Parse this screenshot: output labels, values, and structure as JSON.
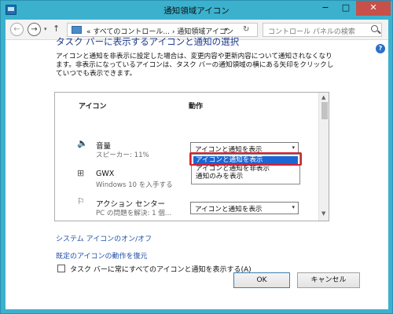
{
  "window": {
    "title": "通知領域アイコン",
    "minimize_glyph": "−",
    "maximize_glyph": "□",
    "close_glyph": "✕"
  },
  "nav": {
    "back_glyph": "←",
    "forward_glyph": "→",
    "history_glyph": "▾",
    "up_glyph": "↑",
    "address_path": "« すべてのコントロール... › 通知領域アイコン",
    "address_chevron": "▾",
    "refresh_glyph": "↻",
    "search_placeholder": "コントロール パネルの検索"
  },
  "help_glyph": "?",
  "main": {
    "heading": "タスク バーに表示するアイコンと通知の選択",
    "description": "アイコンと通知を非表示に設定した場合は、変更内容や更新内容について通知されなくなります。非表示になっているアイコンは、タスク バーの通知領域の横にある矢印をクリックしていつでも表示できます。"
  },
  "table": {
    "col_icon": "アイコン",
    "col_action": "動作",
    "rows": [
      {
        "icon": "speaker-icon",
        "icon_glyph": "🔈",
        "name": "音量",
        "sub": "スピーカー: 11%",
        "action": "アイコンと通知を表示",
        "arrow": "▾"
      },
      {
        "icon": "windows-icon",
        "icon_glyph": "⊞",
        "name": "GWX",
        "sub": "Windows 10 を入手する"
      },
      {
        "icon": "flag-icon",
        "icon_glyph": "⚐",
        "name": "アクション センター",
        "sub": "PC の問題を解決: 1 個...",
        "action": "アイコンと通知を表示",
        "arrow": "▾"
      }
    ],
    "scroll_up": "▲",
    "scroll_down": "▼"
  },
  "dropdown": {
    "options": [
      "アイコンと通知を表示",
      "アイコンと通知を非表示",
      "通知のみを表示"
    ],
    "selected": "アイコンと通知を表示"
  },
  "links": {
    "system_icons": "システム アイコンのオン/オフ",
    "restore_default": "既定のアイコンの動作を復元"
  },
  "checkbox": {
    "label": "タスク バーに常にすべてのアイコンと通知を表示する(A)",
    "checked": false
  },
  "buttons": {
    "ok": "OK",
    "cancel": "キャンセル"
  }
}
